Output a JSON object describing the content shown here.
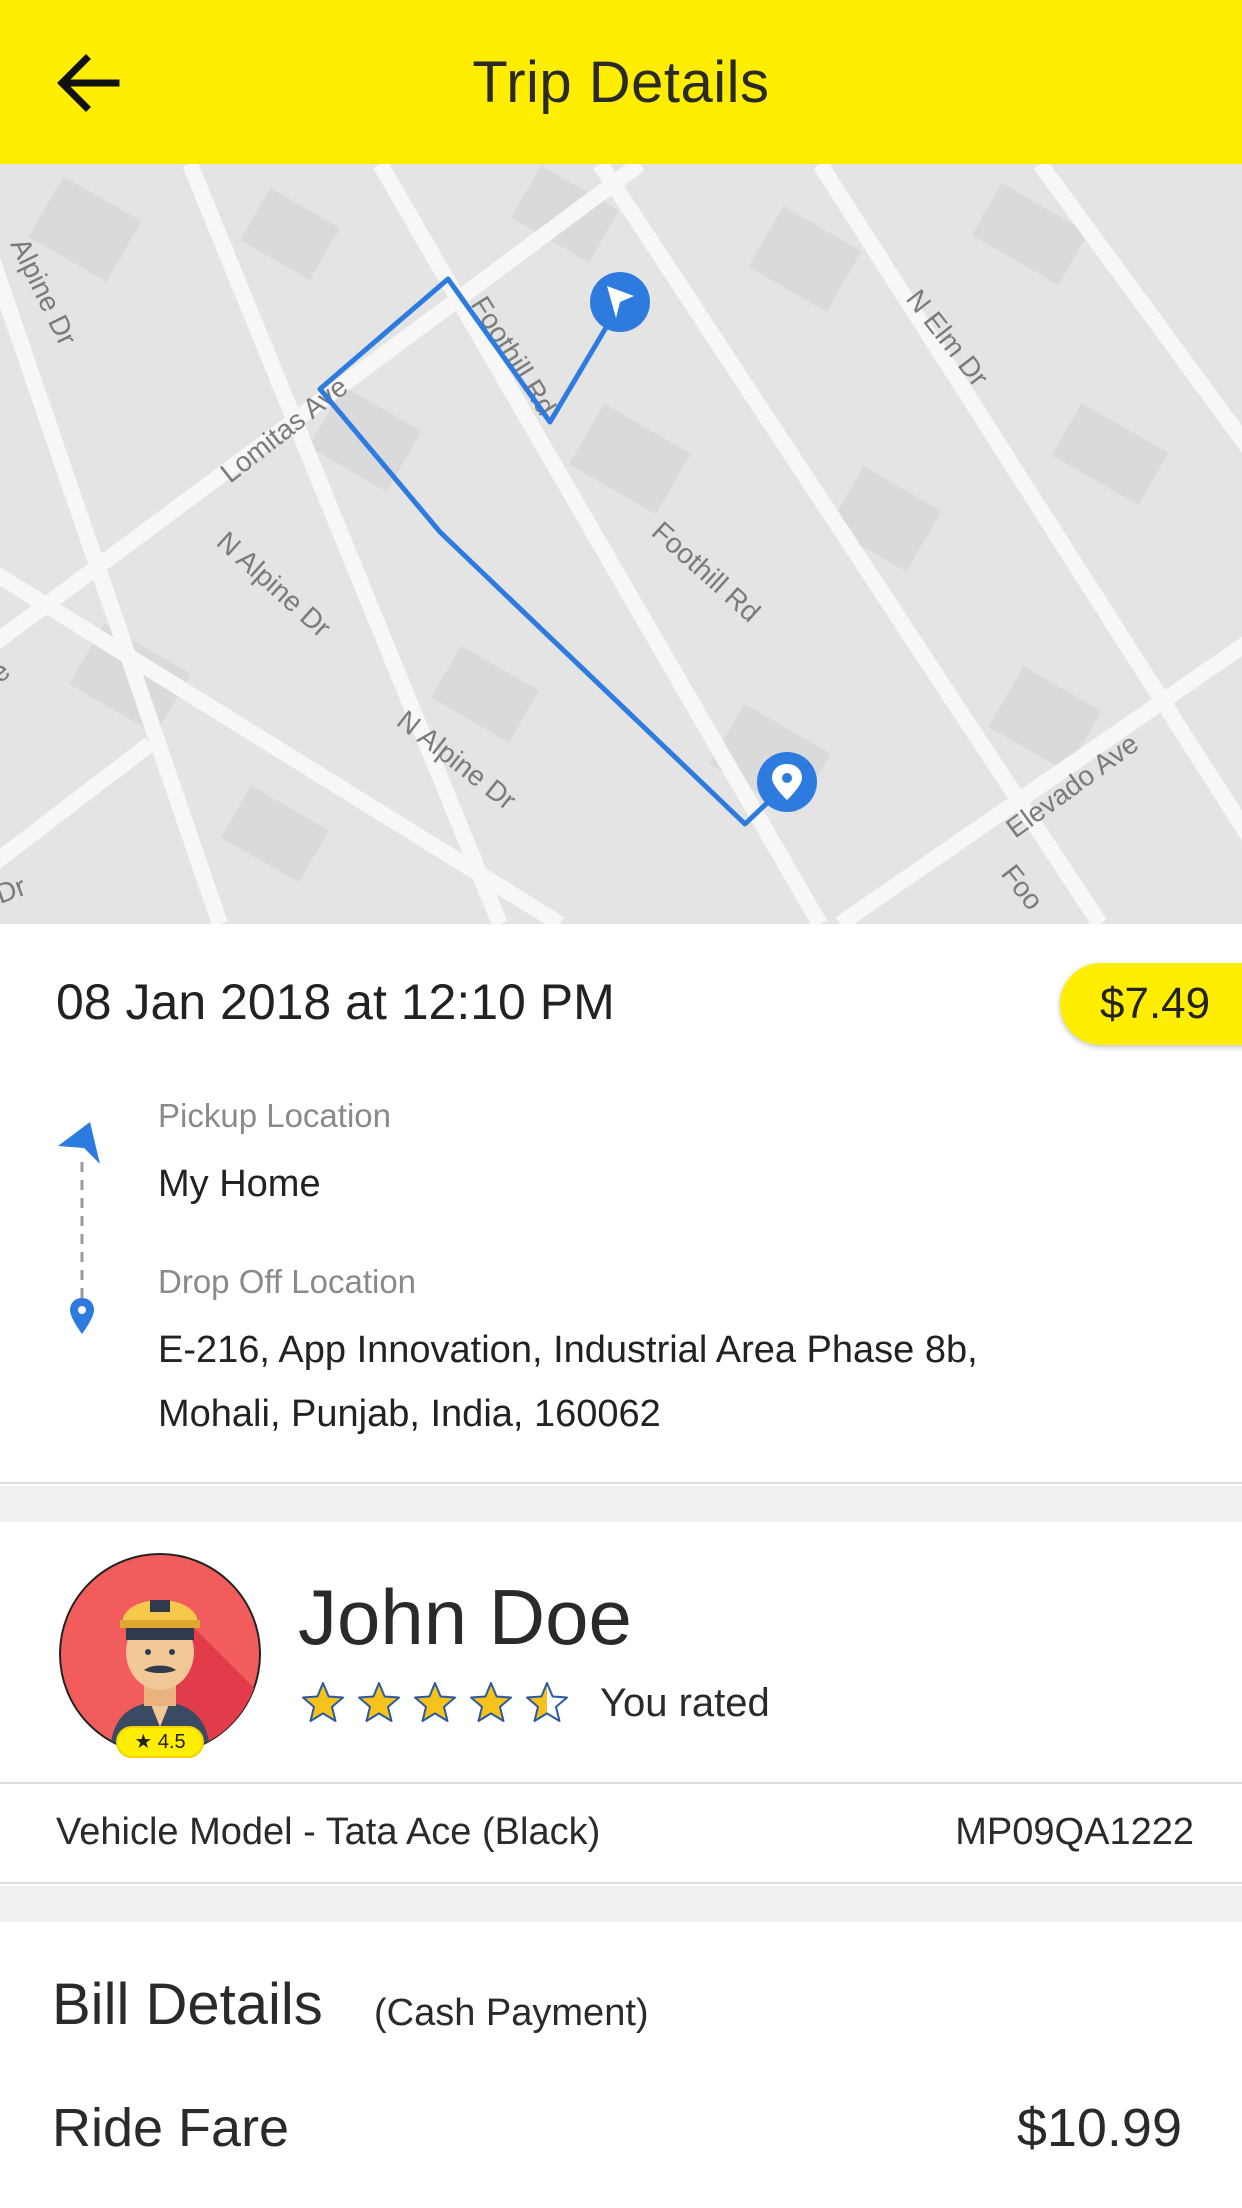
{
  "header": {
    "title": "Trip Details",
    "back_icon": "arrow-left-icon",
    "background": "#FFEE00"
  },
  "map": {
    "street_labels": [
      "Alpine Dr",
      "Lomitas Ave",
      "Foothill Rd",
      "N Elm Dr",
      "N Alpine Dr",
      "N Alpine Dr",
      "Foothill Rd",
      "Elevado Ave",
      "Foo",
      "Dr",
      "e"
    ],
    "route_color": "#2E7BDF",
    "pickup_marker_icon": "navigation-arrow-icon",
    "dropoff_marker_icon": "location-pin-icon"
  },
  "trip": {
    "datetime": "08 Jan 2018 at 12:10 PM",
    "fare": "$7.49",
    "pickup_label": "Pickup Location",
    "pickup_value": "My Home",
    "dropoff_label": "Drop Off Location",
    "dropoff_line1": "E-216, App Innovation, Industrial Area Phase 8b,",
    "dropoff_line2": "Mohali, Punjab, India, 160062"
  },
  "driver": {
    "name": "John Doe",
    "badge_rating": "★ 4.5",
    "user_rating_stars": 4.5,
    "user_rating_max": 5,
    "rated_label": "You rated",
    "vehicle_model": "Vehicle Model - Tata Ace (Black)",
    "vehicle_plate": "MP09QA1222"
  },
  "bill": {
    "title": "Bill Details",
    "subtitle": "(Cash Payment)",
    "rows": [
      {
        "label": "Ride Fare",
        "value": "$10.99"
      }
    ]
  }
}
